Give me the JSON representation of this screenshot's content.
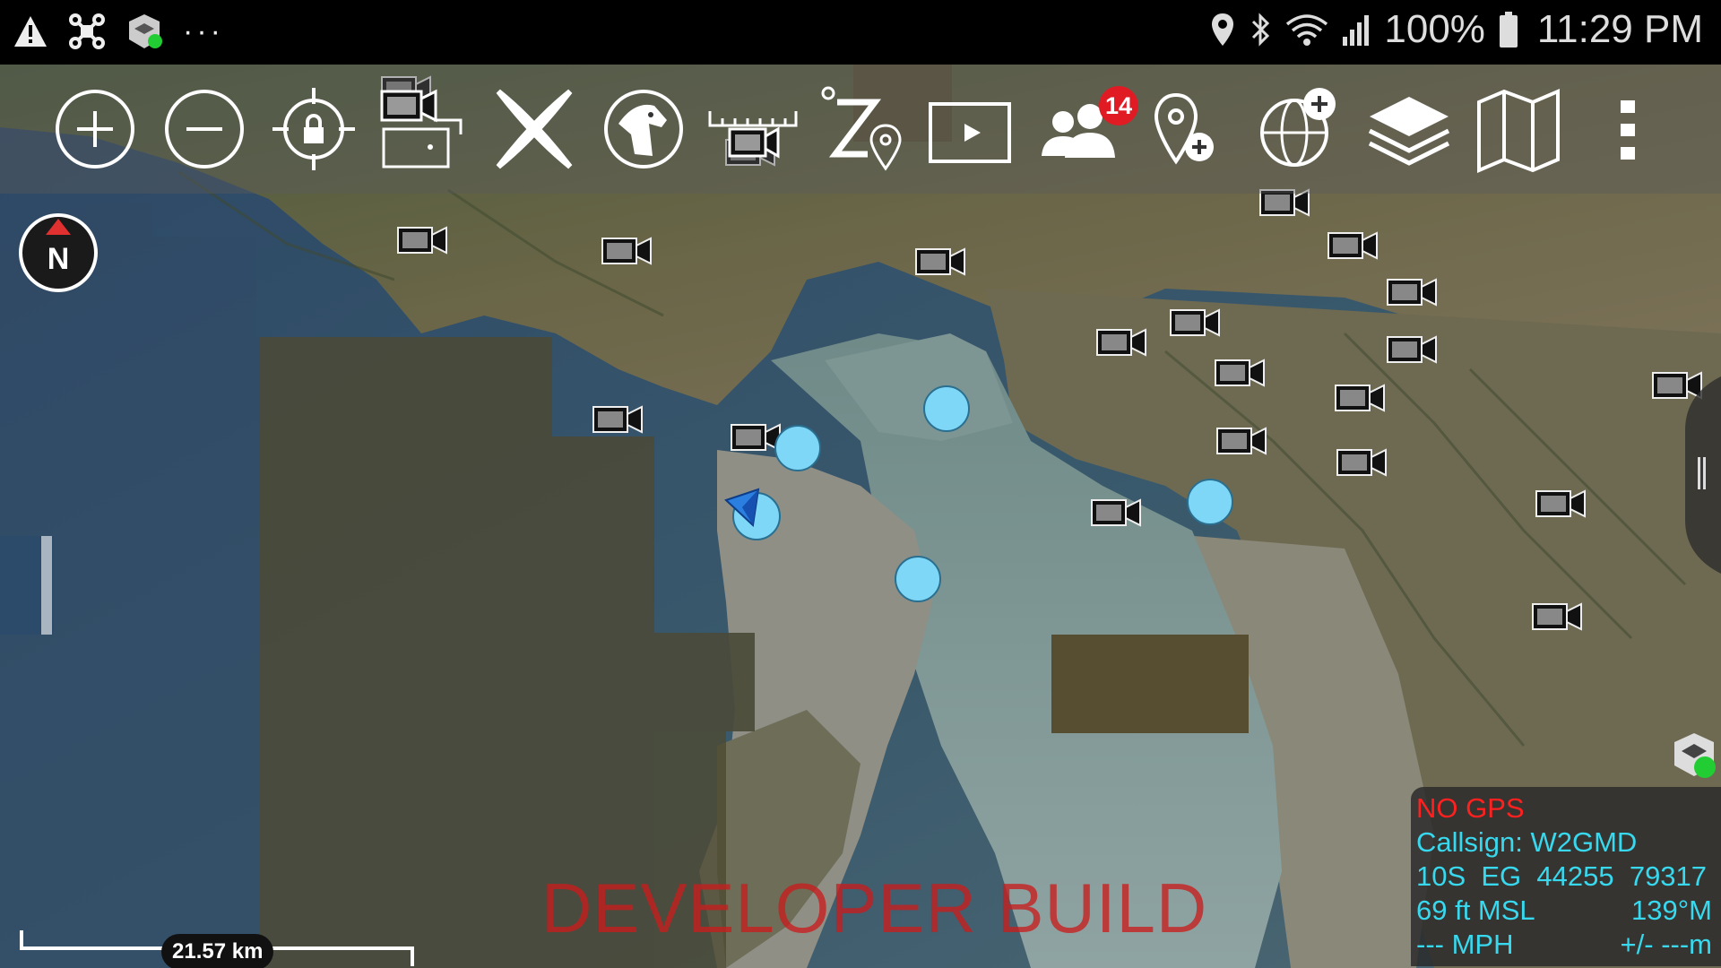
{
  "status_bar": {
    "left_icons": [
      "warning-icon",
      "drone-icon",
      "tak-icon",
      "more-dots-icon"
    ],
    "more_dots": "···",
    "right_icons": [
      "location-icon",
      "bluetooth-icon",
      "wifi-icon",
      "signal-icon",
      "battery-icon"
    ],
    "battery": "100%",
    "time": "11:29 PM"
  },
  "toolbar": {
    "buttons": [
      {
        "name": "zoom-in",
        "icon": "plus-circle-icon"
      },
      {
        "name": "zoom-out",
        "icon": "minus-circle-icon"
      },
      {
        "name": "lock-on-self",
        "icon": "crosshair-lock-icon"
      },
      {
        "name": "video-overlay",
        "icon": "video-window-icon"
      },
      {
        "name": "x-tool",
        "icon": "x-icon"
      },
      {
        "name": "bloodhound",
        "icon": "bloodhound-icon"
      },
      {
        "name": "video-alerts",
        "icon": "video-ruler-icon"
      },
      {
        "name": "range-bearing",
        "icon": "range-bearing-icon"
      },
      {
        "name": "video-player",
        "icon": "play-icon"
      },
      {
        "name": "contacts",
        "icon": "contacts-icon",
        "badge": "14"
      },
      {
        "name": "point-dropper",
        "icon": "add-point-icon"
      },
      {
        "name": "overlay-manager",
        "icon": "globe-plus-icon"
      },
      {
        "name": "layers",
        "icon": "layers-icon"
      },
      {
        "name": "maps",
        "icon": "folded-map-icon"
      },
      {
        "name": "overflow-menu",
        "icon": "vertical-dots-icon"
      }
    ]
  },
  "compass": {
    "label": "N",
    "icon": "compass-icon"
  },
  "map": {
    "video_markers": 21,
    "point_markers": 4,
    "marker_color": "#7fd7f7"
  },
  "watermark": "DEVELOPER BUILD",
  "scale_bar": {
    "label": "21.57 km"
  },
  "info_panel": {
    "gps_status": "NO GPS",
    "callsign": "Callsign: W2GMD",
    "grid": "10S  EG  44255  79317",
    "altitude": "69 ft MSL",
    "heading": "139°M",
    "speed": "--- MPH",
    "accuracy": "+/- ---m"
  },
  "colors": {
    "gps_status": "#ff2020",
    "info_text": "#38d8ee",
    "badge": "#e01b24",
    "watermark": "#c81e1e"
  }
}
